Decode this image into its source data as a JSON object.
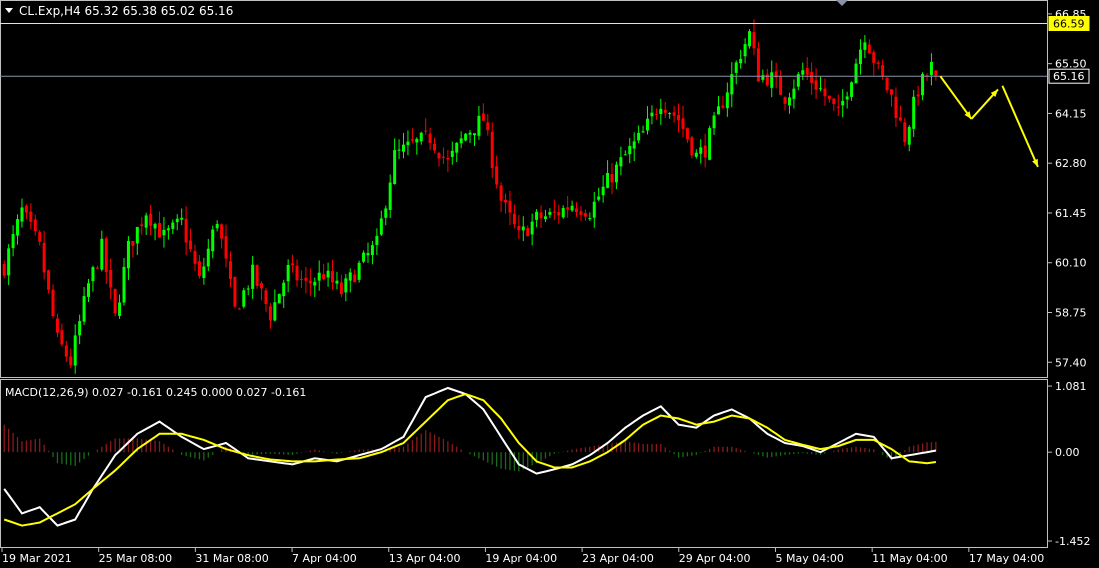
{
  "window": {
    "header": "CL.Exp,H4  65.32 65.38 65.02 65.16",
    "indicator_label": "MACD(12,26,9) 0.027 -0.161 0.245 0.000 0.027 -0.161"
  },
  "colors": {
    "background": "#000000",
    "bull": "#00ff00",
    "bear": "#ff0000",
    "macd_line": "#ffffff",
    "signal_line": "#ffff00",
    "hist_up": "#8b1a1a",
    "hist_down": "#1a6b1a",
    "highlight": "#ffff00",
    "bid_line": "#8a93a6"
  },
  "chart_data": [
    {
      "type": "candlestick",
      "symbol": "CL.Exp",
      "timeframe": "H4",
      "ohlc_last": {
        "open": 65.32,
        "high": 65.38,
        "low": 65.02,
        "close": 65.16
      },
      "y_ticks": [
        "66.85",
        "65.50",
        "64.15",
        "62.80",
        "61.45",
        "60.10",
        "58.75",
        "57.40"
      ],
      "y_range": [
        57.0,
        67.2
      ],
      "price_tags": [
        {
          "value": "66.59",
          "style": "highlight"
        },
        {
          "value": "65.16",
          "style": "bid"
        }
      ],
      "x_ticks": [
        "19 Mar 2021",
        "25 Mar 08:00",
        "31 Mar 08:00",
        "7 Apr 04:00",
        "13 Apr 04:00",
        "19 Apr 04:00",
        "23 Apr 04:00",
        "29 Apr 04:00",
        "5 May 04:00",
        "11 May 04:00",
        "17 May 04:00"
      ],
      "close_path": [
        [
          0,
          60.0
        ],
        [
          4,
          61.5
        ],
        [
          8,
          60.5
        ],
        [
          12,
          58.0
        ],
        [
          15,
          57.4
        ],
        [
          19,
          59.5
        ],
        [
          22,
          60.5
        ],
        [
          25,
          58.6
        ],
        [
          28,
          60.5
        ],
        [
          32,
          61.5
        ],
        [
          36,
          60.8
        ],
        [
          40,
          61.2
        ],
        [
          44,
          59.6
        ],
        [
          48,
          61.3
        ],
        [
          52,
          58.8
        ],
        [
          56,
          59.8
        ],
        [
          60,
          58.7
        ],
        [
          64,
          59.9
        ],
        [
          68,
          59.5
        ],
        [
          72,
          59.8
        ],
        [
          76,
          59.3
        ],
        [
          80,
          60.0
        ],
        [
          84,
          60.6
        ],
        [
          88,
          63.0
        ],
        [
          92,
          63.3
        ],
        [
          96,
          63.5
        ],
        [
          100,
          62.8
        ],
        [
          104,
          63.6
        ],
        [
          108,
          64.0
        ],
        [
          112,
          61.8
        ],
        [
          116,
          60.8
        ],
        [
          120,
          61.3
        ],
        [
          124,
          61.4
        ],
        [
          128,
          61.7
        ],
        [
          132,
          61.5
        ],
        [
          136,
          62.3
        ],
        [
          140,
          63.0
        ],
        [
          144,
          63.6
        ],
        [
          148,
          64.5
        ],
        [
          152,
          64.0
        ],
        [
          156,
          63.0
        ],
        [
          158,
          63.2
        ],
        [
          162,
          64.5
        ],
        [
          166,
          65.8
        ],
        [
          168,
          66.3
        ],
        [
          170,
          65.2
        ],
        [
          173,
          65.1
        ],
        [
          176,
          64.6
        ],
        [
          180,
          65.3
        ],
        [
          184,
          64.8
        ],
        [
          188,
          64.1
        ],
        [
          191,
          65.2
        ],
        [
          194,
          66.3
        ],
        [
          197,
          65.3
        ],
        [
          200,
          64.6
        ],
        [
          203,
          63.5
        ],
        [
          206,
          64.8
        ],
        [
          209,
          65.4
        ],
        [
          210,
          65.16
        ]
      ],
      "projection": [
        [
          211,
          65.16
        ],
        [
          218,
          64.0
        ],
        [
          224,
          64.8
        ]
      ],
      "projection_2": [
        [
          225,
          64.9
        ],
        [
          233,
          62.7
        ]
      ]
    },
    {
      "type": "line",
      "title": "MACD(12,26,9)",
      "values": {
        "macd": 0.027,
        "signal": -0.161
      },
      "y_ticks": [
        "1.081",
        "0.00",
        "-1.452"
      ],
      "y_range": [
        -1.55,
        1.18
      ],
      "series": [
        {
          "style": "macd",
          "points": [
            [
              0,
              -0.6
            ],
            [
              4,
              -1.0
            ],
            [
              8,
              -0.9
            ],
            [
              12,
              -1.2
            ],
            [
              16,
              -1.1
            ],
            [
              20,
              -0.6
            ],
            [
              25,
              -0.05
            ],
            [
              30,
              0.3
            ],
            [
              35,
              0.5
            ],
            [
              40,
              0.25
            ],
            [
              45,
              0.05
            ],
            [
              50,
              0.15
            ],
            [
              55,
              -0.1
            ],
            [
              60,
              -0.15
            ],
            [
              65,
              -0.2
            ],
            [
              70,
              -0.1
            ],
            [
              75,
              -0.15
            ],
            [
              80,
              -0.05
            ],
            [
              85,
              0.05
            ],
            [
              90,
              0.25
            ],
            [
              95,
              0.9
            ],
            [
              100,
              1.05
            ],
            [
              104,
              0.95
            ],
            [
              108,
              0.7
            ],
            [
              112,
              0.25
            ],
            [
              116,
              -0.2
            ],
            [
              120,
              -0.35
            ],
            [
              124,
              -0.28
            ],
            [
              128,
              -0.2
            ],
            [
              132,
              -0.05
            ],
            [
              136,
              0.15
            ],
            [
              140,
              0.4
            ],
            [
              144,
              0.6
            ],
            [
              148,
              0.75
            ],
            [
              152,
              0.45
            ],
            [
              156,
              0.4
            ],
            [
              160,
              0.6
            ],
            [
              164,
              0.7
            ],
            [
              168,
              0.55
            ],
            [
              172,
              0.3
            ],
            [
              176,
              0.15
            ],
            [
              180,
              0.1
            ],
            [
              184,
              0.0
            ],
            [
              188,
              0.15
            ],
            [
              192,
              0.3
            ],
            [
              196,
              0.25
            ],
            [
              200,
              -0.1
            ],
            [
              204,
              -0.05
            ],
            [
              208,
              0.0
            ],
            [
              210,
              0.027
            ]
          ]
        },
        {
          "style": "signal",
          "points": [
            [
              0,
              -1.1
            ],
            [
              4,
              -1.2
            ],
            [
              8,
              -1.15
            ],
            [
              12,
              -1.0
            ],
            [
              16,
              -0.85
            ],
            [
              20,
              -0.6
            ],
            [
              25,
              -0.3
            ],
            [
              30,
              0.05
            ],
            [
              35,
              0.3
            ],
            [
              40,
              0.3
            ],
            [
              45,
              0.2
            ],
            [
              50,
              0.05
            ],
            [
              55,
              -0.05
            ],
            [
              60,
              -0.12
            ],
            [
              65,
              -0.15
            ],
            [
              70,
              -0.15
            ],
            [
              75,
              -0.12
            ],
            [
              80,
              -0.1
            ],
            [
              85,
              0.0
            ],
            [
              90,
              0.15
            ],
            [
              95,
              0.5
            ],
            [
              100,
              0.85
            ],
            [
              104,
              0.95
            ],
            [
              108,
              0.85
            ],
            [
              112,
              0.55
            ],
            [
              116,
              0.15
            ],
            [
              120,
              -0.15
            ],
            [
              124,
              -0.25
            ],
            [
              128,
              -0.25
            ],
            [
              132,
              -0.15
            ],
            [
              136,
              0.0
            ],
            [
              140,
              0.2
            ],
            [
              144,
              0.45
            ],
            [
              148,
              0.6
            ],
            [
              152,
              0.55
            ],
            [
              156,
              0.45
            ],
            [
              160,
              0.5
            ],
            [
              164,
              0.6
            ],
            [
              168,
              0.55
            ],
            [
              172,
              0.4
            ],
            [
              176,
              0.2
            ],
            [
              180,
              0.12
            ],
            [
              184,
              0.05
            ],
            [
              188,
              0.1
            ],
            [
              192,
              0.2
            ],
            [
              196,
              0.2
            ],
            [
              200,
              0.05
            ],
            [
              204,
              -0.15
            ],
            [
              208,
              -0.18
            ],
            [
              210,
              -0.161
            ]
          ]
        }
      ]
    }
  ]
}
